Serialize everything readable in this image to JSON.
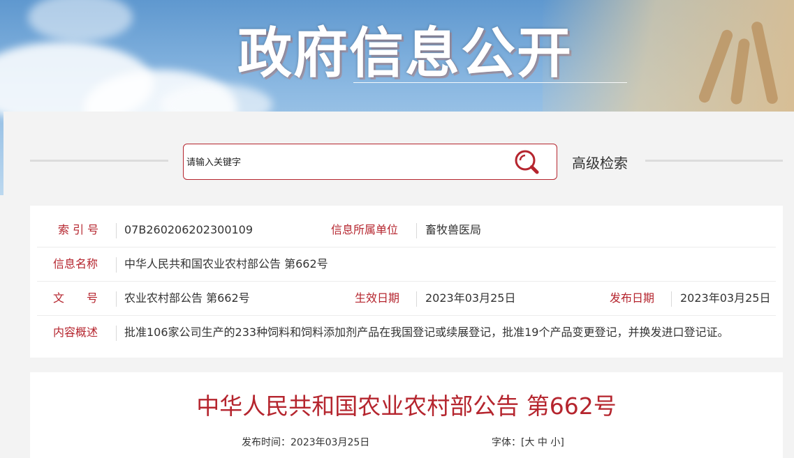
{
  "banner": {
    "title": "政府信息公开"
  },
  "search": {
    "placeholder": "请输入关键字",
    "advanced_label": "高级检索"
  },
  "info": {
    "index_label": "索 引 号",
    "index_value": "07B260206202300109",
    "unit_label": "信息所属单位",
    "unit_value": "畜牧兽医局",
    "name_label": "信息名称",
    "name_value": "中华人民共和国农业农村部公告 第662号",
    "doc_label": "文　　号",
    "doc_value": "农业农村部公告 第662号",
    "effective_label": "生效日期",
    "effective_value": "2023年03月25日",
    "publish_label": "发布日期",
    "publish_value": "2023年03月25日",
    "summary_label": "内容概述",
    "summary_value": "批准106家公司生产的233种饲料和饲料添加剂产品在我国登记或续展登记，批准19个产品变更登记，并换发进口登记证。"
  },
  "article": {
    "title": "中华人民共和国农业农村部公告 第662号",
    "publish_time_label": "发布时间：",
    "publish_time": "2023年03月25日",
    "font_label": "字体：",
    "font_open": "[",
    "font_large": "大",
    "font_medium": "中",
    "font_small": "小",
    "font_close": "]"
  },
  "colors": {
    "accent": "#b5252e",
    "text": "#333333",
    "page_bg": "#f3f3f3"
  }
}
